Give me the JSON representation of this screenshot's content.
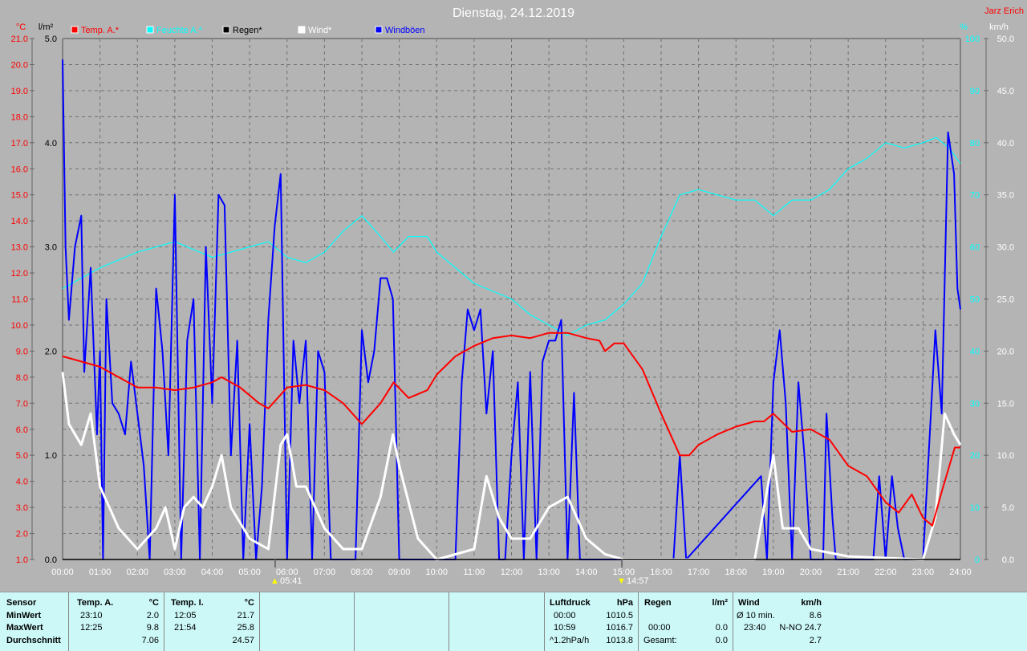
{
  "title": "Dienstag, 24.12.2019",
  "author": "Jarz Erich",
  "colors": {
    "temp": "#ff0000",
    "humidity": "#00ffff",
    "rain": "#000000",
    "wind": "#ffffff",
    "gusts": "#0000ff"
  },
  "chart_data": {
    "type": "line",
    "title": "Dienstag, 24.12.2019",
    "x_range_hours": [
      0,
      24
    ],
    "x_ticks": [
      "00:00",
      "01:00",
      "02:00",
      "03:00",
      "04:00",
      "05:00",
      "06:00",
      "07:00",
      "08:00",
      "09:00",
      "10:00",
      "11:00",
      "12:00",
      "13:00",
      "14:00",
      "15:00",
      "16:00",
      "17:00",
      "18:00",
      "19:00",
      "20:00",
      "21:00",
      "22:00",
      "23:00",
      "24:00"
    ],
    "axes": {
      "temp": {
        "unit": "°C",
        "range": [
          1,
          21
        ],
        "ticks": [
          "21.0",
          "20.0",
          "19.0",
          "18.0",
          "17.0",
          "16.0",
          "15.0",
          "14.0",
          "13.0",
          "12.0",
          "11.0",
          "10.0",
          "9.0",
          "8.0",
          "7.0",
          "6.0",
          "5.0",
          "4.0",
          "3.0",
          "2.0",
          "1.0"
        ]
      },
      "rain": {
        "unit": "l/m²",
        "range": [
          0,
          5
        ],
        "ticks": [
          "5.0",
          "4.0",
          "3.0",
          "2.0",
          "1.0",
          "0.0"
        ]
      },
      "humidity": {
        "unit": "%",
        "range": [
          0,
          100
        ],
        "ticks": [
          "100",
          "90",
          "80",
          "70",
          "60",
          "50",
          "40",
          "30",
          "20",
          "10",
          "0"
        ]
      },
      "wind": {
        "unit": "km/h",
        "range": [
          0,
          50
        ],
        "ticks": [
          "50.0",
          "45.0",
          "40.0",
          "35.0",
          "30.0",
          "25.0",
          "20.0",
          "15.0",
          "10.0",
          "5.0",
          "0.0"
        ]
      }
    },
    "legend": [
      "Temp. A.*",
      "Feuchte A.*",
      "Regen*",
      "Wind*",
      "Windböen"
    ],
    "legend_placement": "top",
    "grid": true,
    "annotations": {
      "sunrise": "05:41",
      "sunset": "14:57"
    },
    "series": [
      {
        "name": "Temp. A.",
        "axis": "temp",
        "x": [
          0,
          0.5,
          1,
          1.5,
          2,
          2.5,
          3,
          3.5,
          4,
          4.25,
          4.75,
          5.25,
          5.5,
          6,
          6.5,
          7,
          7.5,
          8,
          8.5,
          8.85,
          9.25,
          9.75,
          10,
          10.5,
          11,
          11.5,
          12,
          12.5,
          13,
          13.5,
          14,
          14.35,
          14.5,
          14.75,
          15,
          15.5,
          16,
          16.5,
          16.75,
          17,
          17.5,
          18,
          18.5,
          18.75,
          19,
          19.5,
          20,
          20.5,
          21,
          21.5,
          22,
          22.35,
          22.7,
          23,
          23.25,
          23.5,
          23.85,
          24
        ],
        "y": [
          8.8,
          8.6,
          8.4,
          8.0,
          7.6,
          7.6,
          7.5,
          7.6,
          7.8,
          8.0,
          7.6,
          7.0,
          6.8,
          7.6,
          7.7,
          7.5,
          7.0,
          6.2,
          7.0,
          7.8,
          7.2,
          7.5,
          8.1,
          8.8,
          9.2,
          9.5,
          9.6,
          9.5,
          9.7,
          9.7,
          9.5,
          9.4,
          9.0,
          9.3,
          9.3,
          8.3,
          6.6,
          5.0,
          5.0,
          5.4,
          5.8,
          6.1,
          6.3,
          6.3,
          6.6,
          5.9,
          6.0,
          5.6,
          4.6,
          4.2,
          3.2,
          2.8,
          3.5,
          2.6,
          2.3,
          3.6,
          5.3,
          5.3
        ]
      },
      {
        "name": "Feuchte A.",
        "axis": "humidity",
        "x": [
          0,
          1,
          2,
          3,
          4,
          5,
          5.5,
          6,
          6.5,
          7,
          7.5,
          8,
          8.5,
          8.85,
          9.25,
          9.75,
          10,
          11,
          12,
          12.5,
          13,
          13.5,
          14,
          14.5,
          15,
          15.5,
          16,
          16.5,
          17,
          17.5,
          18,
          18.5,
          19,
          19.5,
          20,
          20.5,
          21,
          21.5,
          22,
          22.5,
          23,
          23.35,
          23.7,
          24
        ],
        "y": [
          52,
          56,
          59,
          61,
          58,
          60,
          61,
          58,
          57,
          59,
          63,
          66,
          62,
          59,
          62,
          62,
          59,
          53,
          50,
          47,
          45,
          43,
          45,
          46,
          49,
          53,
          62,
          70,
          71,
          70,
          69,
          69,
          66,
          69,
          69,
          71,
          75,
          77,
          80,
          79,
          80,
          81,
          79,
          76
        ]
      },
      {
        "name": "Regen",
        "axis": "rain",
        "x": [
          0,
          24
        ],
        "y": [
          0,
          0
        ]
      },
      {
        "name": "Wind",
        "axis": "wind",
        "x": [
          0,
          0.17,
          0.5,
          0.75,
          1,
          1.25,
          1.5,
          2,
          2.5,
          2.75,
          3,
          3.25,
          3.5,
          3.75,
          4,
          4.25,
          4.5,
          5,
          5.5,
          5.83,
          6,
          6.25,
          6.5,
          7,
          7.5,
          8,
          8.5,
          8.83,
          9,
          9.5,
          10,
          11,
          11.33,
          11.67,
          12,
          12.5,
          13,
          13.5,
          14,
          14.5,
          15,
          18.5,
          19,
          19.25,
          19.67,
          20,
          21,
          23,
          23.33,
          23.58,
          23.83,
          24
        ],
        "y": [
          18,
          13,
          11,
          14,
          7,
          5,
          3,
          1,
          3,
          5,
          1,
          5,
          6,
          5,
          7,
          10,
          5,
          2,
          1,
          11,
          12,
          7,
          7,
          3,
          1,
          1,
          6,
          12,
          9,
          2,
          0,
          1,
          8,
          4,
          2,
          2,
          5,
          6,
          2,
          0.5,
          0,
          0,
          10,
          3,
          3,
          1,
          0.3,
          0,
          4,
          14,
          12,
          11
        ]
      },
      {
        "name": "Windböen",
        "axis": "wind",
        "x": [
          0,
          0.08,
          0.17,
          0.33,
          0.5,
          0.58,
          0.75,
          0.92,
          1,
          1.08,
          1.17,
          1.33,
          1.5,
          1.67,
          1.83,
          2,
          2.17,
          2.33,
          2.5,
          2.67,
          2.83,
          3,
          3.17,
          3.33,
          3.5,
          3.67,
          3.83,
          4,
          4.17,
          4.33,
          4.5,
          4.67,
          4.83,
          5,
          5.17,
          5.33,
          5.5,
          5.67,
          5.83,
          6,
          6.17,
          6.33,
          6.5,
          6.67,
          6.83,
          7,
          7.17,
          7.83,
          8,
          8.17,
          8.33,
          8.5,
          8.67,
          8.83,
          9,
          9.17,
          10.5,
          10.67,
          10.83,
          11,
          11.17,
          11.33,
          11.5,
          11.67,
          11.83,
          12,
          12.17,
          12.33,
          12.5,
          12.67,
          12.83,
          13,
          13.17,
          13.33,
          13.5,
          13.67,
          13.83,
          14,
          16.33,
          16.5,
          16.67,
          18.67,
          18.83,
          19,
          19.17,
          19.33,
          19.5,
          19.67,
          19.83,
          20,
          20.33,
          20.42,
          20.58,
          20.67,
          21.67,
          21.83,
          22,
          22.17,
          22.33,
          22.5,
          23,
          23.33,
          23.5,
          23.67,
          23.83,
          23.92,
          24
        ],
        "y": [
          48,
          30,
          23,
          30,
          33,
          18,
          28,
          12,
          20,
          0,
          25,
          15,
          14,
          12,
          19,
          14,
          9,
          0,
          26,
          20,
          10,
          35,
          0,
          21,
          25,
          0,
          30,
          15,
          35,
          34,
          10,
          21,
          0,
          13,
          0,
          7,
          23,
          32,
          37,
          0,
          21,
          15,
          21,
          0,
          20,
          18,
          0,
          0,
          22,
          17,
          20,
          27,
          27,
          25,
          0,
          0,
          0,
          17,
          24,
          22,
          24,
          14,
          20,
          0,
          0,
          10,
          17,
          0,
          18,
          0,
          19,
          21,
          21,
          23,
          0,
          16,
          0,
          0,
          0,
          10,
          0,
          8,
          0,
          17,
          22,
          15,
          0,
          17,
          10,
          0,
          0,
          14,
          4,
          0,
          0,
          8,
          0,
          8,
          3,
          0,
          0,
          22,
          14,
          41,
          37,
          26,
          24
        ]
      }
    ]
  },
  "footer": {
    "sensor": {
      "header": "Sensor",
      "rows": [
        "MinWert",
        "MaxWert",
        "Durchschnitt"
      ]
    },
    "temp_a": {
      "header": "Temp. A.",
      "unit": "°C",
      "min_time": "23:10",
      "min": "2.0",
      "max_time": "12:25",
      "max": "9.8",
      "avg": "7.06"
    },
    "temp_i": {
      "header": "Temp. I.",
      "unit": "°C",
      "min_time": "12:05",
      "min": "21.7",
      "max_time": "21:54",
      "max": "25.8",
      "avg": "24.57"
    },
    "pressure": {
      "header": "Luftdruck",
      "unit": "hPa",
      "min_time": "00:00",
      "min": "1010.5",
      "max_time": "10:59",
      "max": "1016.7",
      "trend": "^1.2hPa/h",
      "avg": "1013.8"
    },
    "rain": {
      "header": "Regen",
      "unit": "l/m²",
      "time": "00:00",
      "value": "0.0",
      "total_label": "Gesamt:",
      "total": "0.0"
    },
    "wind": {
      "header": "Wind",
      "unit": "km/h",
      "avg_label": "Ø 10 min.",
      "avg": "8.6",
      "max_time": "23:40",
      "max": "N-NO 24.7",
      "mean": "2.7"
    }
  }
}
